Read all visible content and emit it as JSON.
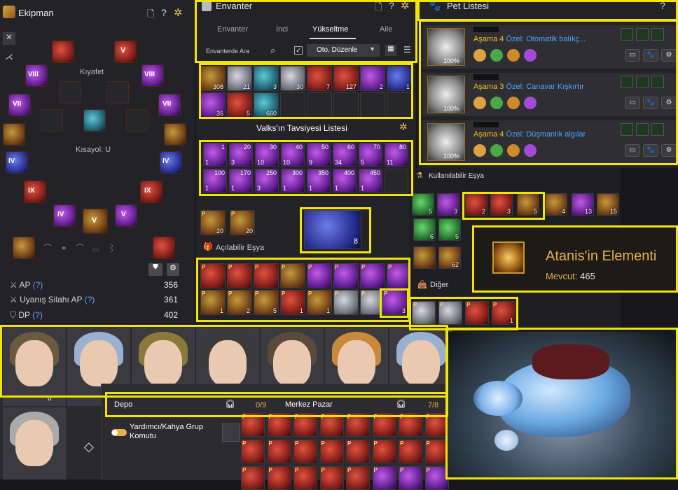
{
  "equipment": {
    "title": "Ekipman",
    "outfit_label": "Kıyafet",
    "shortcut_label": "Kısayol: U",
    "slot_numerals": [
      "VIII",
      "V",
      "VIII",
      "VII",
      "VII",
      "V",
      "IV",
      "IV",
      "IX",
      "IX",
      "V",
      "IV",
      "V"
    ],
    "stats": [
      {
        "label": "AP",
        "help": "(?)",
        "value": "356"
      },
      {
        "label": "Uyanış Silahı AP",
        "help": "(?)",
        "value": "361"
      },
      {
        "label": "DP",
        "help": "(?)",
        "value": "402"
      }
    ]
  },
  "inventory": {
    "title": "Envanter",
    "tabs": [
      "Envanter",
      "İnci",
      "Yükseltme",
      "Aile"
    ],
    "active_tab": "Yükseltme",
    "search_placeholder": "Envanterde Ara",
    "auto_sort_label": "Oto. Düzenle",
    "row1": [
      "308",
      "21",
      "3",
      "30",
      "7",
      "127",
      "2",
      "1"
    ],
    "row2": [
      "35",
      "5",
      "660"
    ],
    "valks_title": "Valks'ın Tavsiyesi Listesi",
    "valks_levels_row1": [
      "1",
      "20",
      "30",
      "40",
      "50",
      "60",
      "70",
      "80"
    ],
    "valks_counts_row1": [
      "1",
      "3",
      "10",
      "10",
      "9",
      "34",
      "5",
      "11"
    ],
    "valks_levels_row2": [
      "100",
      "170",
      "250",
      "300",
      "350",
      "400",
      "450"
    ],
    "valks_counts_row2": [
      "1",
      "1",
      "3",
      "1",
      "1",
      "1",
      "1"
    ],
    "extra_counts": [
      "20",
      "20"
    ],
    "featured_count": "8",
    "openable_title": "Açılabilir Eşya",
    "openable_row2_counts": [
      "1",
      "2",
      "5",
      "1",
      "1",
      "",
      "",
      ""
    ],
    "openable_last_count": "3"
  },
  "pets": {
    "title": "Pet Listesi",
    "help": "?",
    "list": [
      {
        "stage_label": "Aşama",
        "stage": "4",
        "skill": "Özel: Otomatik balıkç...",
        "hunger": "100%"
      },
      {
        "stage_label": "Aşama",
        "stage": "3",
        "skill": "Özel: Canavar Kışkırtır",
        "hunger": "100%"
      },
      {
        "stage_label": "Aşama",
        "stage": "4",
        "skill": "Özel: Düşmanlık algılar",
        "hunger": "100%"
      }
    ]
  },
  "usable": {
    "title": "Kullanılabilir Eşya",
    "counts": [
      "5",
      "3",
      "2",
      "3",
      "5",
      "4",
      "13",
      "15",
      "6",
      "5",
      "62"
    ],
    "other_title": "Diğer",
    "other_counts": [
      "",
      "",
      "",
      "1"
    ]
  },
  "tooltip": {
    "name": "Atanis'in Elementi",
    "available_label": "Mevcut:",
    "available_value": "465"
  },
  "storage": {
    "depo_label": "Depo",
    "depo_count": "0/9",
    "market_label": "Merkez Pazar",
    "market_count": "7/8",
    "toggle_label": "Yardımcı/Kahya Grup Komutu",
    "char_count": "0"
  },
  "colors": {
    "highlight": "#f2e407",
    "stage": "#f0c020",
    "skill": "#4ea6ff",
    "tooltip_gold": "#e8b14a"
  }
}
